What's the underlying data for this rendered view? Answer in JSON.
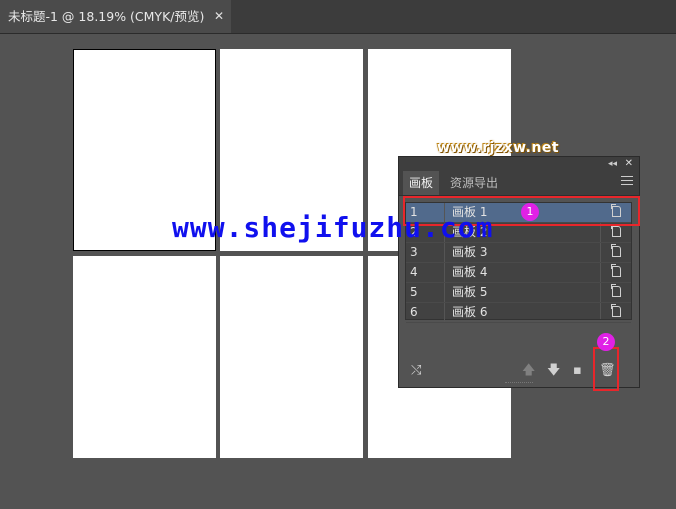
{
  "document_tab": {
    "title": "未标题-1 @ 18.19% (CMYK/预览)",
    "close_glyph": "✕"
  },
  "watermarks": {
    "small": "www.rjzxw.net",
    "large": "www.shejifuzhu.com"
  },
  "panel": {
    "collapse_glyph": "◂◂",
    "close_glyph": "✕",
    "tabs": [
      {
        "label": "画板"
      },
      {
        "label": "资源导出"
      }
    ],
    "artboards": [
      {
        "num": "1",
        "name": "画板 1"
      },
      {
        "num": "2",
        "name": "画板 2"
      },
      {
        "num": "3",
        "name": "画板 3"
      },
      {
        "num": "4",
        "name": "画板 4"
      },
      {
        "num": "5",
        "name": "画板 5"
      },
      {
        "num": "6",
        "name": "画板 6"
      }
    ],
    "selected_index": 0,
    "footer_icons": [
      "rearrange-icon",
      "move-up-icon",
      "move-down-icon",
      "new-artboard-icon",
      "trash-icon"
    ]
  },
  "callouts": [
    {
      "label": "1"
    },
    {
      "label": "2"
    }
  ],
  "colors": {
    "highlight": "#e8262b",
    "badge": "#e021e6",
    "selection": "#516a8c",
    "watermark_blue": "#1010ee"
  }
}
